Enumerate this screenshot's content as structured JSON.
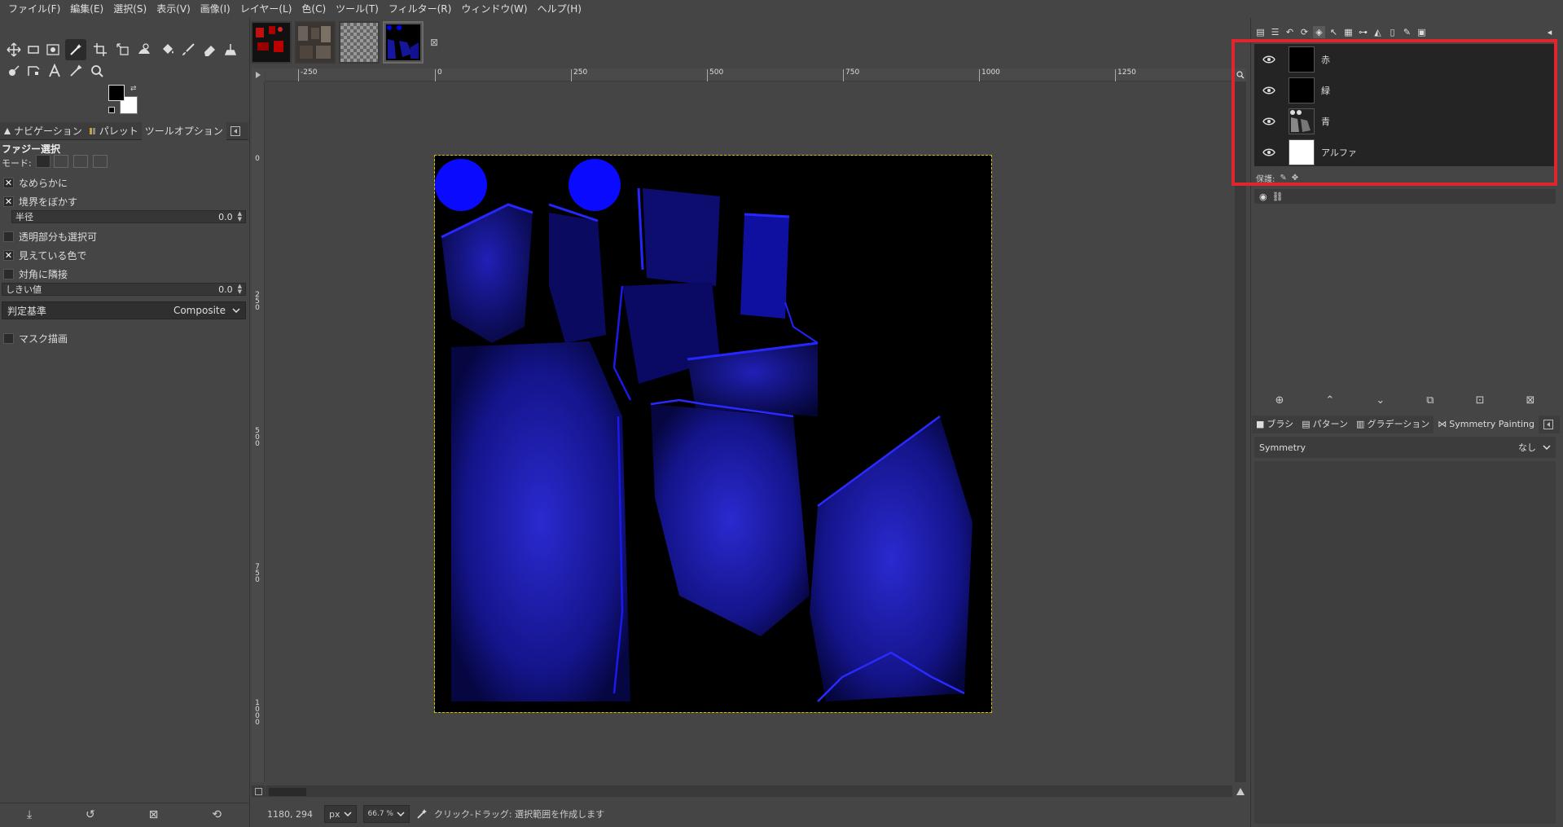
{
  "menu": [
    "ファイル(F)",
    "編集(E)",
    "選択(S)",
    "表示(V)",
    "画像(I)",
    "レイヤー(L)",
    "色(C)",
    "ツール(T)",
    "フィルター(R)",
    "ウィンドウ(W)",
    "ヘルプ(H)"
  ],
  "left_tabs": [
    "ナビゲーション",
    "パレット",
    "ツールオプション"
  ],
  "tool_options": {
    "title": "ファジー選択",
    "mode_label": "モード:",
    "smooth_label": "なめらかに",
    "feather_label": "境界をぼかす",
    "radius_label": "半径",
    "radius_value": "0.0",
    "select_transparent_label": "透明部分も選択可",
    "sample_merged_label": "見えている色で",
    "diagonal_label": "対角に隣接",
    "threshold_label": "しきい値",
    "threshold_value": "0.0",
    "criterion_label": "判定基準",
    "criterion_value": "Composite",
    "draw_mask_label": "マスク描画"
  },
  "ruler_h": [
    "-250",
    "0",
    "250",
    "500",
    "750",
    "1000",
    "1250"
  ],
  "ruler_v": [
    "0",
    "250",
    "500",
    "750",
    "1000"
  ],
  "status": {
    "coords": "1180, 294",
    "unit": "px",
    "zoom": "66.7 %",
    "message": "クリック-ドラッグ: 選択範囲を作成します"
  },
  "channels": [
    {
      "name": "赤"
    },
    {
      "name": "緑"
    },
    {
      "name": "青"
    },
    {
      "name": "アルファ"
    }
  ],
  "lock_label": "保護:",
  "bottom_tabs": [
    "ブラシ",
    "パターン",
    "グラデーション",
    "Symmetry Painting"
  ],
  "symmetry": {
    "label": "Symmetry",
    "value": "なし"
  }
}
